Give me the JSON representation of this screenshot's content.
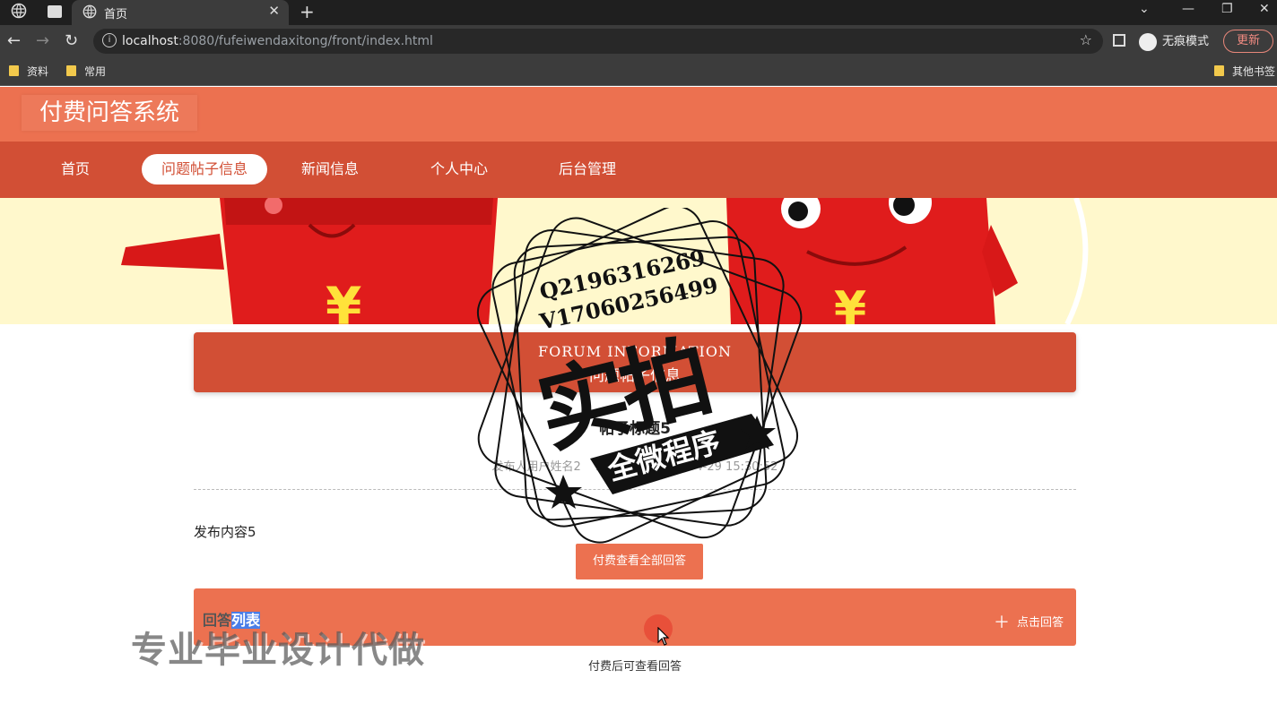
{
  "browser": {
    "tab_title": "首页",
    "url_host": "localhost",
    "url_rest": ":8080/fufeiwendaxitong/front/index.html",
    "incognito_label": "无痕模式",
    "update_label": "更新",
    "bookmarks": [
      "资料",
      "常用"
    ],
    "other_bookmarks": "其他书签"
  },
  "site": {
    "title": "付费问答系统",
    "nav": [
      "首页",
      "问题帖子信息",
      "新闻信息",
      "个人中心",
      "后台管理"
    ],
    "active_nav": 1
  },
  "section": {
    "title_en": "FORUM INFORMATION",
    "title_cn": "问题帖子信息"
  },
  "post": {
    "title": "帖子标题5",
    "author_label": "发布人用户姓名2",
    "time_label": "发布时间：2022-04-29 15:30:52",
    "content": "发布内容5",
    "pay_button": "付费查看全部回答"
  },
  "answers": {
    "title_part1": "回答",
    "title_part2": "列表",
    "add_label": "点击回答",
    "pay_note": "付费后可查看回答"
  },
  "overlay": {
    "stamp_line1": "Q2196316269",
    "stamp_line2": "V17060256499",
    "stamp_big": "实拍",
    "stamp_ribbon": "全微程序",
    "watermark": "专业毕业设计代做"
  },
  "colors": {
    "header": "#ec7150",
    "nav": "#d24f35",
    "accent": "#ec7150"
  }
}
